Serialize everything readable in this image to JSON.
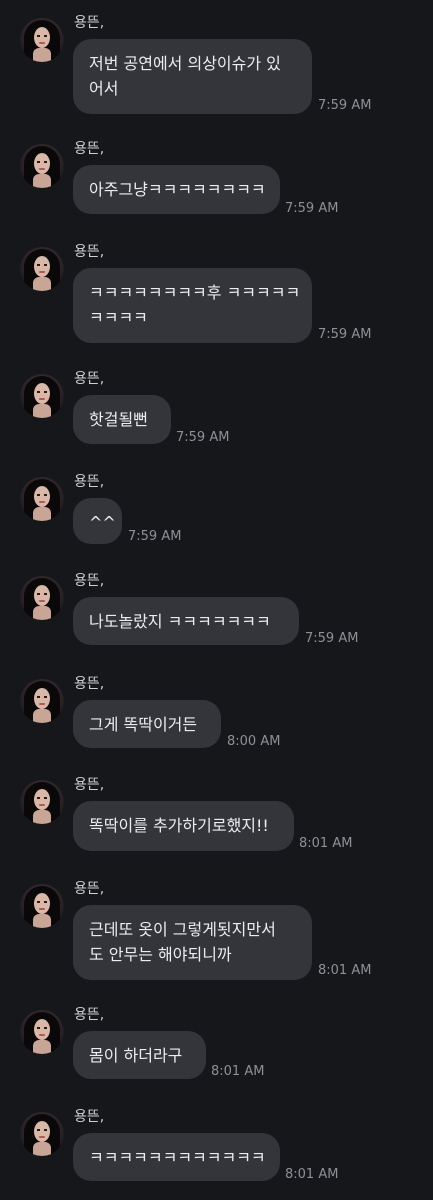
{
  "sender_name": "용뜬,",
  "messages": [
    {
      "lines": [
        "저번 공연에서 의상이슈가 있",
        "어서"
      ],
      "time": "7:59 AM"
    },
    {
      "lines": [
        "아주그냥ㅋㅋㅋㅋㅋㅋㅋㅋ"
      ],
      "time": "7:59 AM"
    },
    {
      "lines": [
        "ㅋㅋㅋㅋㅋㅋㅋㅋ후 ㅋㅋㅋㅋㅋ",
        "ㅋㅋㅋㅋ"
      ],
      "time": "7:59 AM"
    },
    {
      "lines": [
        "핫걸될뻔"
      ],
      "time": "7:59 AM"
    },
    {
      "lines": [
        "^^"
      ],
      "time": "7:59 AM"
    },
    {
      "lines": [
        "나도놀랐지 ㅋㅋㅋㅋㅋㅋㅋ"
      ],
      "time": "7:59 AM"
    },
    {
      "lines": [
        "그게 똑딱이거든"
      ],
      "time": "8:00 AM"
    },
    {
      "lines": [
        "똑딱이를 추가하기로했지!!"
      ],
      "time": "8:01 AM"
    },
    {
      "lines": [
        "근데또 옷이 그렇게됫지만서",
        "도 안무는 해야되니까"
      ],
      "time": "8:01 AM"
    },
    {
      "lines": [
        "몸이 하더라구"
      ],
      "time": "8:01 AM"
    },
    {
      "lines": [
        "ㅋㅋㅋㅋㅋㅋㅋㅋㅋㅋㅋㅋ"
      ],
      "time": "8:01 AM"
    }
  ]
}
